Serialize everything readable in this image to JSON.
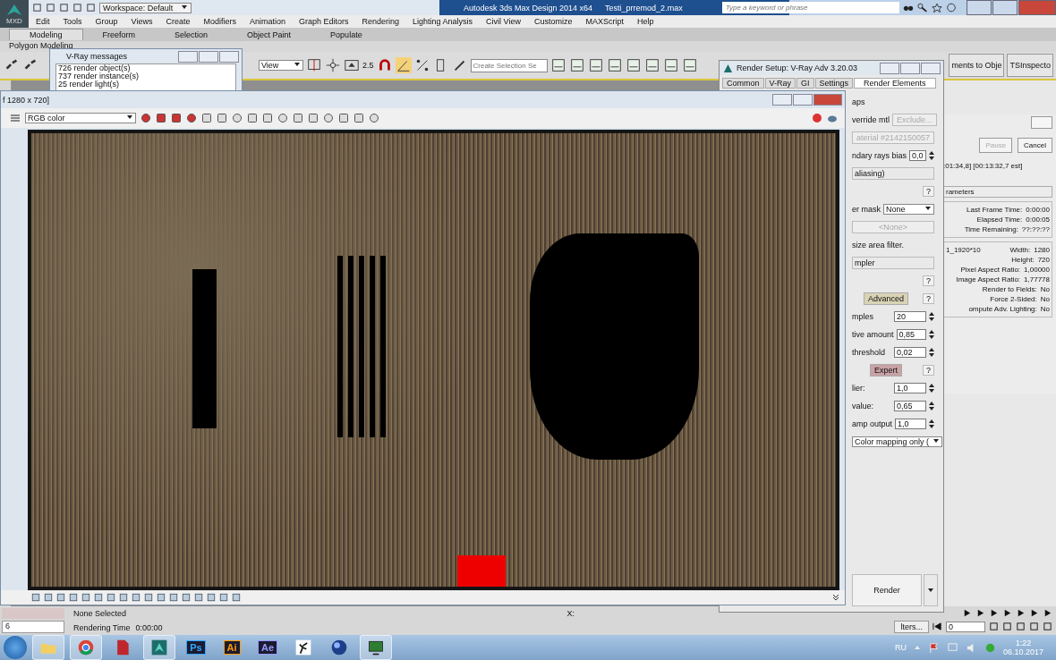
{
  "app_window": {
    "app_button": "MXD",
    "workspace": "Workspace: Default",
    "title": "Autodesk 3ds Max Design 2014 x64",
    "file_name": "Testi_prremod_2.max",
    "search": {
      "placeholder": "Type a keyword or phrase"
    }
  },
  "menu_bar": [
    "Edit",
    "Tools",
    "Group",
    "Views",
    "Create",
    "Modifiers",
    "Animation",
    "Graph Editors",
    "Rendering",
    "Lighting Analysis",
    "Civil View",
    "Customize",
    "MAXScript",
    "Help"
  ],
  "ribbon_tabs": [
    {
      "label": "Modeling",
      "selected": true
    },
    {
      "label": "Freeform",
      "selected": false
    },
    {
      "label": "Selection",
      "selected": false
    },
    {
      "label": "Object Paint",
      "selected": false
    },
    {
      "label": "Populate",
      "selected": false
    }
  ],
  "ribbon_panel": "Polygon Modeling",
  "toolbar": {
    "view_dropdown": "View",
    "snap_value": "2.5",
    "selection_set": {
      "placeholder": "Create Selection Se"
    },
    "buttons": [
      "ments to Obje",
      "TSInspecto"
    ]
  },
  "vray_messages": {
    "title": "V-Ray messages",
    "lines": [
      "726 render object(s)",
      "737 render instance(s)",
      "25 render light(s)"
    ]
  },
  "frame_buffer": {
    "title": "f 1280 x 720]",
    "channel": "RGB color"
  },
  "render_setup": {
    "title": "Render Setup: V-Ray Adv 3.20.03",
    "tabs": [
      {
        "label": "Common",
        "selected": false
      },
      {
        "label": "V-Ray",
        "selected": false
      },
      {
        "label": "GI",
        "selected": false
      },
      {
        "label": "Settings",
        "selected": false
      },
      {
        "label": "Render Elements",
        "selected": true
      }
    ],
    "rows": [
      {
        "kind": "text",
        "text": "aps"
      },
      {
        "kind": "button",
        "label": "verride mtl",
        "button": "Exclude..."
      },
      {
        "kind": "disabled",
        "text": "aterial #2142150057"
      },
      {
        "kind": "spinner",
        "label": "ndary rays bias",
        "value": "0,0"
      },
      {
        "kind": "rollout",
        "text": "aliasing)"
      },
      {
        "kind": "help",
        "button": "?"
      },
      {
        "kind": "dropdown",
        "label": "er mask",
        "value": "None"
      },
      {
        "kind": "disabled",
        "text": "<None>"
      },
      {
        "kind": "text",
        "text": "size area filter."
      },
      {
        "kind": "rollout",
        "text": "mpler"
      },
      {
        "kind": "help",
        "button": "?"
      },
      {
        "kind": "mode",
        "button": "Advanced",
        "help": "?",
        "color": "#d9d3b5"
      },
      {
        "kind": "spinner",
        "label": "mples",
        "value": "20"
      },
      {
        "kind": "spinner",
        "label": "tive amount",
        "value": "0,85"
      },
      {
        "kind": "spinner",
        "label": "threshold",
        "value": "0,02"
      },
      {
        "kind": "mode",
        "button": "Expert",
        "help": "?",
        "color": "#c9a2a6"
      },
      {
        "kind": "spinner",
        "label": "lier:",
        "value": "1,0"
      },
      {
        "kind": "spinner",
        "label": "value:",
        "value": "0,65"
      },
      {
        "kind": "spinner",
        "label": "amp output",
        "value": "1,0"
      },
      {
        "kind": "dropdown",
        "value": "Color mapping only ("
      }
    ],
    "render_button": "Render"
  },
  "progress": {
    "pause": "Pause",
    "cancel": "Cancel",
    "time_line": ":01:34,8] [00:13:32,7 est]",
    "section": "rameters",
    "stats": [
      {
        "label": "Last Frame Time:",
        "value": "0:00:00"
      },
      {
        "label": "Elapsed Time:",
        "value": "0:00:05"
      },
      {
        "label": "Time Remaining:",
        "value": "??:??:??"
      }
    ],
    "output_name": "1_1920*10",
    "output": [
      {
        "label": "Width:",
        "value": "1280"
      },
      {
        "label": "Height:",
        "value": "720"
      },
      {
        "label": "Pixel Aspect Ratio:",
        "value": "1,00000"
      },
      {
        "label": "Image Aspect Ratio:",
        "value": "1,77778"
      },
      {
        "label": "Render to Fields:",
        "value": "No"
      },
      {
        "label": "Force 2-Sided:",
        "value": "No"
      },
      {
        "label": "ompute Adv. Lighting:",
        "value": "No"
      }
    ]
  },
  "status_bar": {
    "frame_field": "6",
    "selection": "None Selected",
    "rendering_time_label": "Rendering Time",
    "rendering_time": "0:00:00",
    "coord_label": "X:",
    "filters": "lters...",
    "frame_value": "0"
  },
  "taskbar": {
    "apps": [
      {
        "kind": "folder",
        "active": true
      },
      {
        "kind": "chrome",
        "active": true
      },
      {
        "kind": "acrobat",
        "active": false
      },
      {
        "kind": "max",
        "active": true
      },
      {
        "kind": "letters",
        "text": "Ps",
        "color": "#31a8ff",
        "active": false
      },
      {
        "kind": "letters",
        "text": "Ai",
        "color": "#ff9a00",
        "active": false
      },
      {
        "kind": "letters",
        "text": "Ae",
        "color": "#9999ff",
        "active": false
      },
      {
        "kind": "runner",
        "active": false
      },
      {
        "kind": "sphere",
        "active": false
      },
      {
        "kind": "monitor",
        "active": true
      }
    ],
    "language": "RU",
    "time": "1:22",
    "date": "06.10.2017"
  }
}
